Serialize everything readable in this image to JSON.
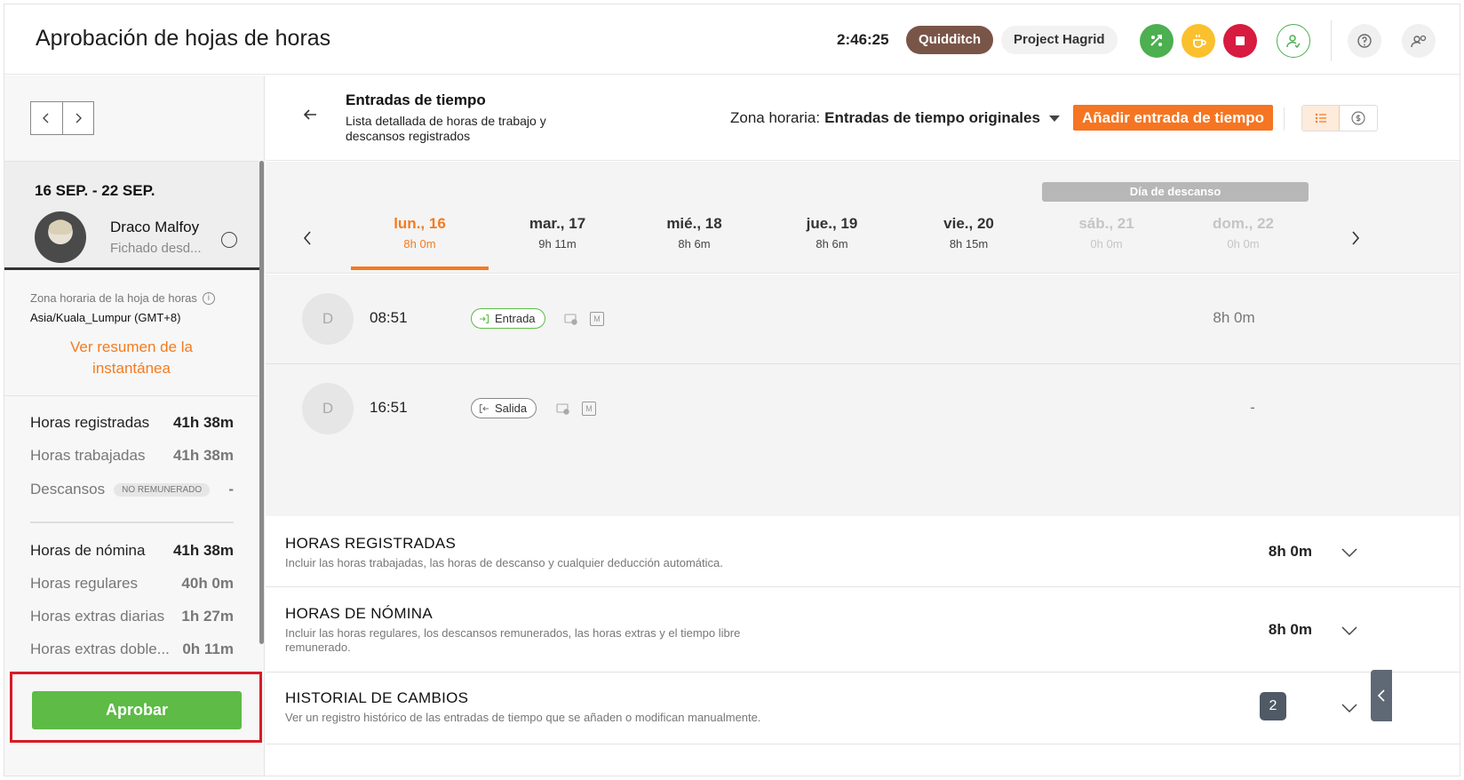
{
  "header": {
    "title": "Aprobación de hojas de horas",
    "timer": "2:46:25",
    "activity_chip": "Quidditch",
    "project_chip": "Project Hagrid",
    "icons": [
      "switch-activity-icon",
      "take-break-icon",
      "stop-icon",
      "user-icon",
      "help-icon",
      "admin-icon"
    ],
    "colors": {
      "switch": "#4caf50",
      "break": "#fbc02d",
      "stop": "#d81b40",
      "activity_chip": "#795548"
    }
  },
  "sidebar": {
    "week_range": "16 SEP. - 22 SEP.",
    "user": {
      "name": "Draco Malfoy",
      "status": "Fichado desd..."
    },
    "timezone_label": "Zona horaria de la hoja de horas",
    "timezone_value": "Asia/Kuala_Lumpur (GMT+8)",
    "snapshot_link": "Ver resumen de la instantánea",
    "stats": [
      {
        "label": "Horas registradas",
        "value": "41h 38m",
        "bold": true
      },
      {
        "label": "Horas trabajadas",
        "value": "41h 38m",
        "bold": false
      },
      {
        "label": "Descansos",
        "badge": "NO REMUNERADO",
        "value": "-",
        "bold": false
      }
    ],
    "payroll_stats": [
      {
        "label": "Horas de nómina",
        "value": "41h 38m",
        "bold": true
      },
      {
        "label": "Horas regulares",
        "value": "40h 0m",
        "bold": false
      },
      {
        "label": "Horas extras diarias",
        "value": "1h 27m",
        "bold": false
      },
      {
        "label": "Horas extras doble...",
        "value": "0h 11m",
        "bold": false
      }
    ],
    "approve_button": "Aprobar",
    "approve_color": "#5dbb46"
  },
  "toolbar": {
    "title": "Entradas de tiempo",
    "subtitle": "Lista detallada de horas de trabajo y descansos registrados",
    "tz_prefix": "Zona horaria:",
    "tz_value": "Entradas de tiempo originales",
    "add_button": "Añadir entrada de tiempo",
    "accent": "#f57522"
  },
  "days": {
    "rest_banner": "Día de descanso",
    "items": [
      {
        "name": "lun., 16",
        "hours": "8h 0m",
        "state": "active"
      },
      {
        "name": "mar., 17",
        "hours": "9h 11m",
        "state": "normal"
      },
      {
        "name": "mié., 18",
        "hours": "8h 6m",
        "state": "normal"
      },
      {
        "name": "jue., 19",
        "hours": "8h 6m",
        "state": "normal"
      },
      {
        "name": "vie., 20",
        "hours": "8h 15m",
        "state": "normal"
      },
      {
        "name": "sáb., 21",
        "hours": "0h 0m",
        "state": "off"
      },
      {
        "name": "dom., 22",
        "hours": "0h 0m",
        "state": "off"
      }
    ]
  },
  "entries": [
    {
      "avatar": "D",
      "time": "08:51",
      "type": "Entrada",
      "m": "M",
      "duration": "8h 0m"
    },
    {
      "avatar": "D",
      "time": "16:51",
      "type": "Salida",
      "m": "M",
      "duration": "-"
    }
  ],
  "sections": [
    {
      "title": "HORAS REGISTRADAS",
      "desc": "Incluir las horas trabajadas, las horas de descanso y cualquier deducción automática.",
      "value": "8h 0m"
    },
    {
      "title": "HORAS DE NÓMINA",
      "desc": "Incluir las horas regulares, los descansos remunerados, las horas extras y el tiempo libre remunerado.",
      "value": "8h 0m"
    },
    {
      "title": "HISTORIAL DE CAMBIOS",
      "desc": "Ver un registro histórico de las entradas de tiempo que se añaden o modifican manualmente.",
      "count": "2"
    }
  ]
}
